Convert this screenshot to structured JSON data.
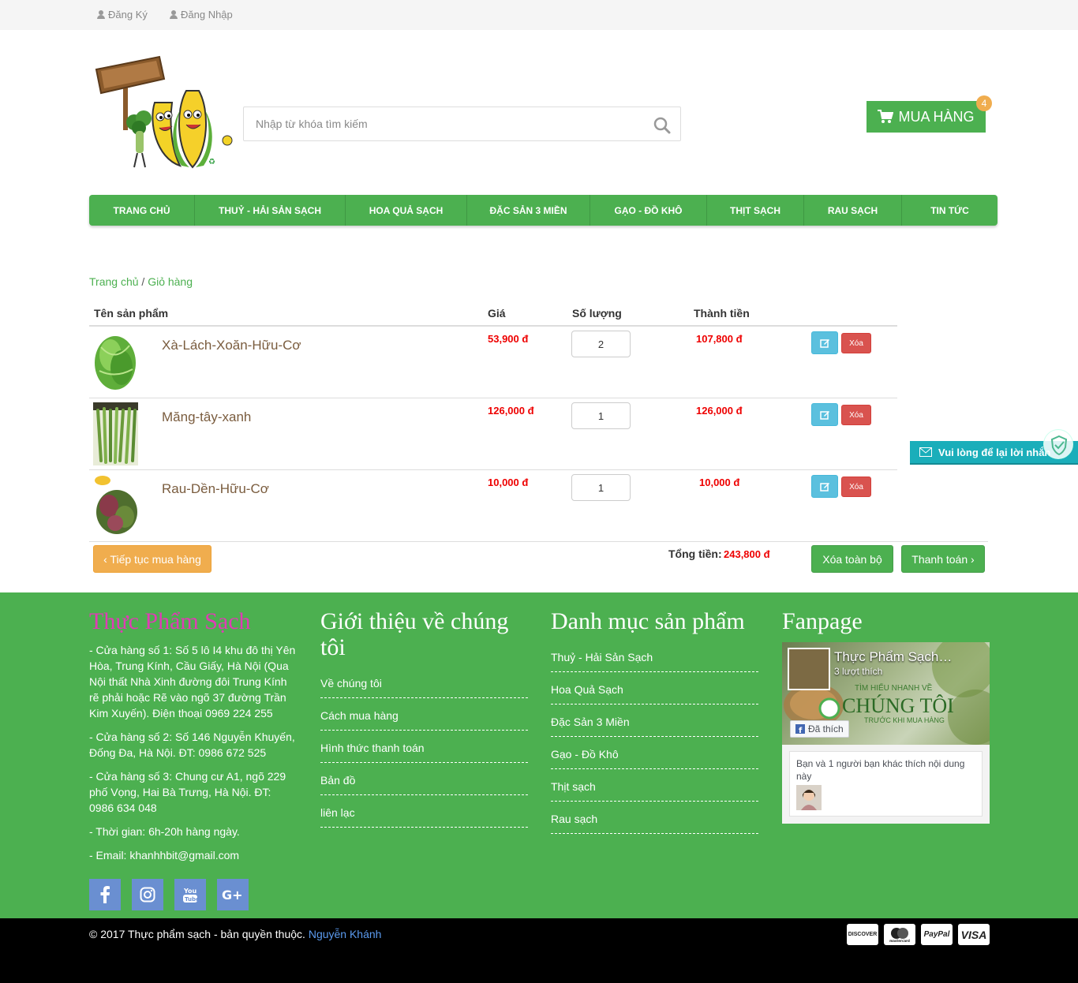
{
  "topbar": {
    "register": "Đăng Ký",
    "login": "Đăng Nhập"
  },
  "header": {
    "search_placeholder": "Nhập từ khóa tìm kiếm",
    "cart_label": "MUA HÀNG",
    "cart_count": "4"
  },
  "nav": [
    {
      "label": "TRANG CHỦ"
    },
    {
      "label": "THUỶ - HẢI SẢN SẠCH"
    },
    {
      "label": "HOA QUẢ SẠCH"
    },
    {
      "label": "ĐẶC SẢN 3 MIỀN"
    },
    {
      "label": "GẠO - ĐỒ KHÔ"
    },
    {
      "label": "THỊT SẠCH"
    },
    {
      "label": "RAU SẠCH"
    },
    {
      "label": "TIN TỨC"
    }
  ],
  "breadcrumb": {
    "home": "Trang chủ",
    "sep": "/",
    "current": "Giỏ hàng"
  },
  "table": {
    "headers": [
      "Tên sản phẩm",
      "Giá",
      "Số lượng",
      "Thành tiền"
    ],
    "rows": [
      {
        "name": "Xà-Lách-Xoăn-Hữu-Cơ",
        "price": "53,900 đ",
        "qty": "2",
        "subtotal": "107,800 đ",
        "delete": "Xóa"
      },
      {
        "name": "Măng-tây-xanh",
        "price": "126,000 đ",
        "qty": "1",
        "subtotal": "126,000 đ",
        "delete": "Xóa"
      },
      {
        "name": "Rau-Dền-Hữu-Cơ",
        "price": "10,000 đ",
        "qty": "1",
        "subtotal": "10,000 đ",
        "delete": "Xóa"
      }
    ]
  },
  "actions": {
    "continue": "‹ Tiếp tục mua hàng",
    "total_label": "Tổng tiền:",
    "total_value": "243,800 đ",
    "clear_all": "Xóa toàn bộ",
    "checkout": "Thanh toán ›"
  },
  "message_widget": "Vui lòng để lại lời nhắn",
  "footer": {
    "col1": {
      "title": "Thực Phẩm Sạch",
      "lines": [
        "- Cửa hàng số 1: Số 5 lô I4 khu đô thị Yên Hòa, Trung Kính, Cầu Giấy, Hà Nội (Qua Nội thất Nhà Xinh đường đôi Trung Kính rẽ phải hoặc Rẽ vào ngõ 37 đường Trần Kim Xuyến). Điện thoại 0969 224 255",
        "- Cửa hàng số 2: Số 146 Nguyễn Khuyến, Đống Đa, Hà Nội. ĐT: 0986 672 525",
        "- Cửa hàng số 3: Chung cư A1, ngõ 229 phố Vọng, Hai Bà Trưng, Hà Nội. ĐT: 0986 634 048",
        "- Thời gian: 6h-20h hàng ngày.",
        "- Email: khanhhbit@gmail.com"
      ]
    },
    "col2": {
      "title": "Giới thiệu về chúng tôi",
      "links": [
        "Về chúng tôi",
        "Cách mua hàng",
        "Hình thức thanh toán",
        "Bản đồ",
        "liên lạc"
      ]
    },
    "col3": {
      "title": "Danh mục sản phẩm",
      "links": [
        "Thuỷ - Hải Sản Sạch",
        "Hoa Quả Sạch",
        "Đặc Sản 3 Miền",
        "Gạo - Đồ Khô",
        "Thịt sạch",
        "Rau sạch"
      ]
    },
    "col4": {
      "title": "Fanpage",
      "page_name": "Thực Phẩm Sạch…",
      "likes": "3 lượt thích",
      "liked_btn": "Đã thích",
      "cover_line1": "TÌM HIỂU NHANH VỀ",
      "cover_line2": "CHÚNG TÔI",
      "cover_line3": "TRƯỚC KHI MUA HÀNG",
      "friends_text": "Bạn và 1 người bạn khác thích nội dung này"
    }
  },
  "bottom": {
    "copyright": "© 2017 Thực phẩm sạch - bản quyền thuộc.",
    "author": "Nguyễn Khánh",
    "payments": [
      "DISCOVER",
      "mastercard",
      "PayPal",
      "VISA"
    ]
  },
  "colors": {
    "brand_green": "#4cb050",
    "price_red": "#ee0000",
    "footer_title_pink": "#e03bb5"
  }
}
